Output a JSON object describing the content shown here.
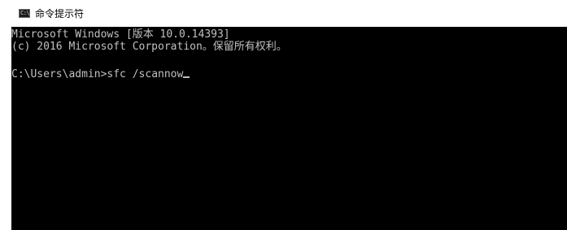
{
  "window": {
    "title": "命令提示符",
    "icon": "cmd-icon",
    "icon_glyph": "C:\\"
  },
  "console": {
    "lines": [
      "Microsoft Windows [版本 10.0.14393]",
      "(c) 2016 Microsoft Corporation。保留所有权利。"
    ],
    "prompt": "C:\\Users\\admin>",
    "command": "sfc /scannow"
  },
  "colors": {
    "console_background": "#000000",
    "console_text": "#c0c0c0",
    "titlebar_background": "#ffffff"
  }
}
